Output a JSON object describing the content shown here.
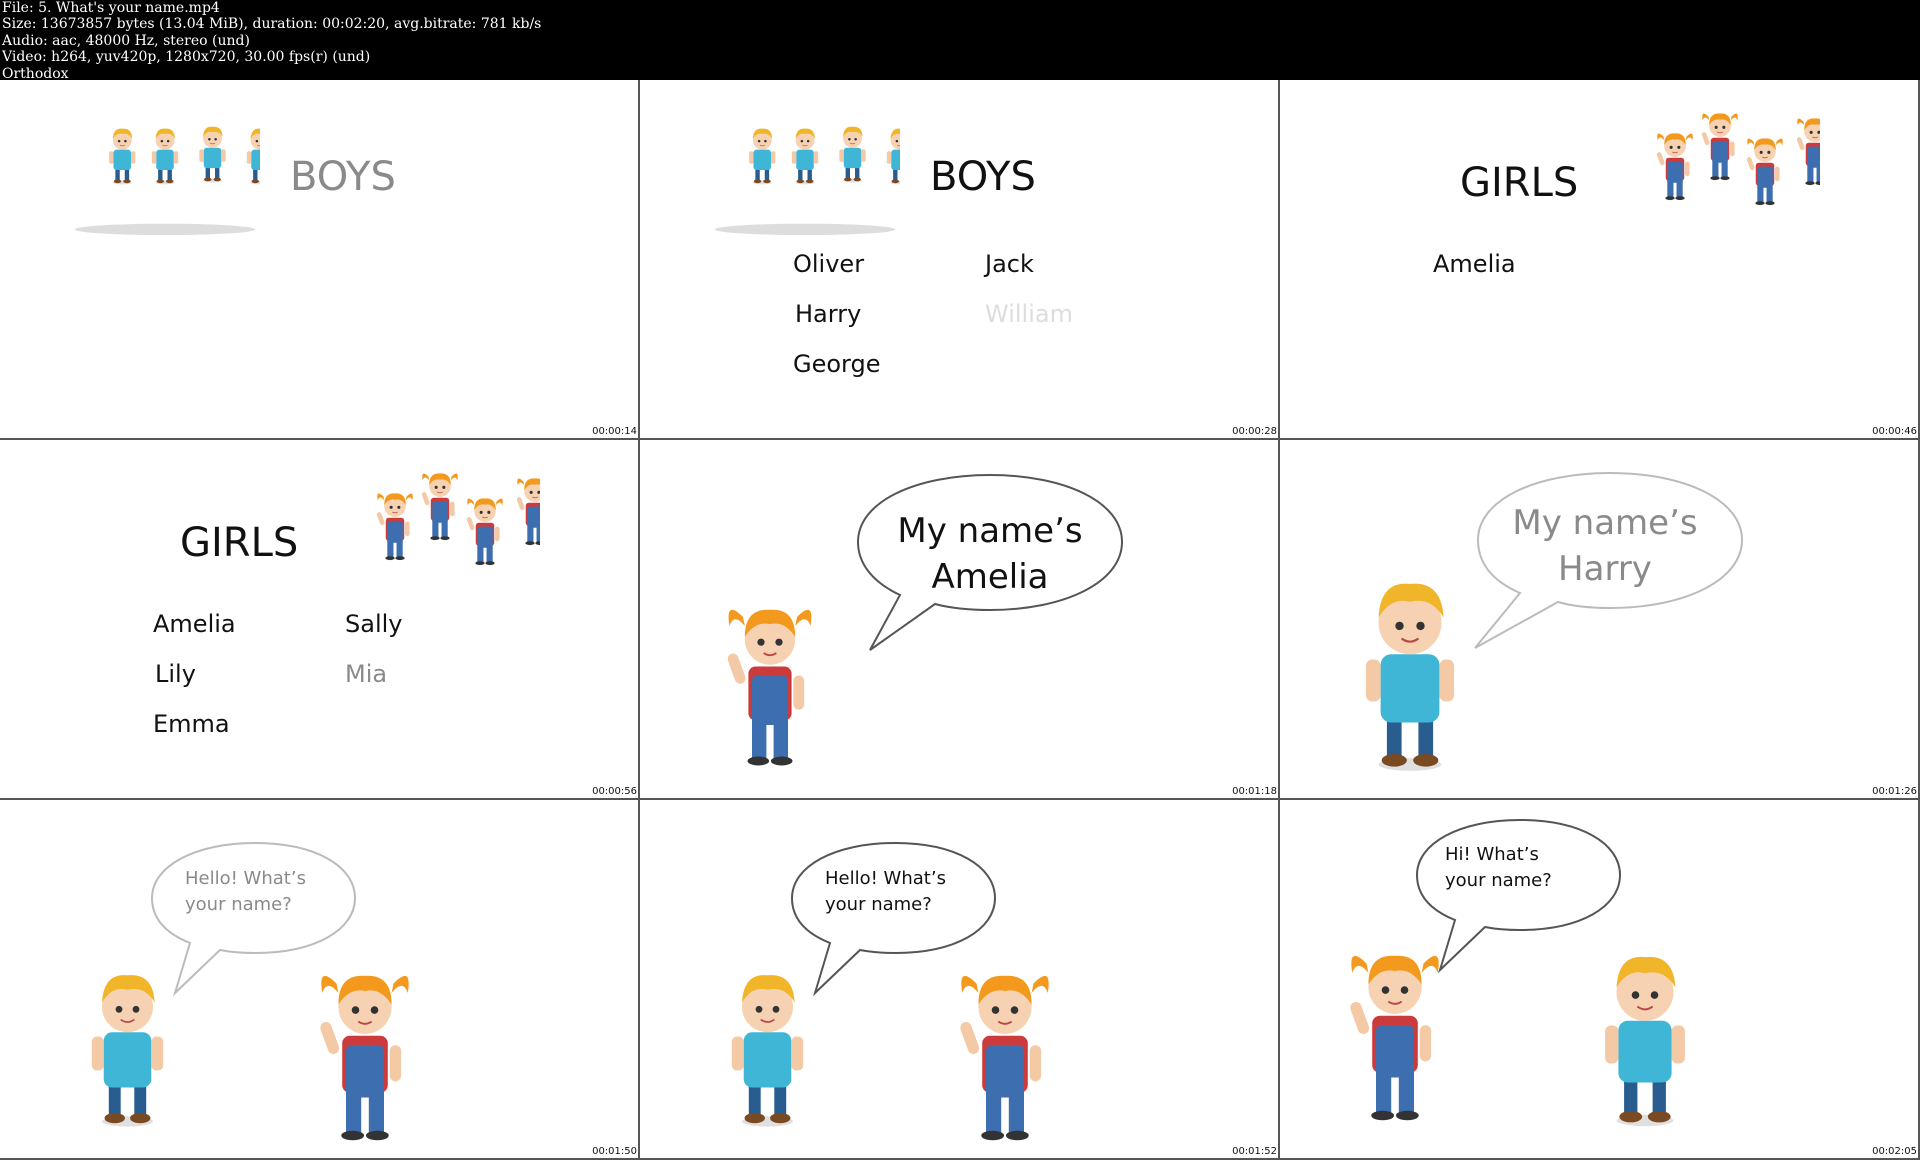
{
  "header": {
    "file": "File: 5. What's your name.mp4",
    "size": "Size: 13673857 bytes (13.04 MiB), duration: 00:02:20, avg.bitrate: 781 kb/s",
    "audio": "Audio: aac, 48000 Hz, stereo (und)",
    "video": "Video: h264, yuv420p, 1280x720, 30.00 fps(r) (und)",
    "tag": "Orthodox"
  },
  "frames": [
    {
      "timestamp": "00:00:14",
      "title": "BOYS"
    },
    {
      "timestamp": "00:00:28",
      "title": "BOYS",
      "names": [
        "Oliver",
        "Jack",
        "Harry",
        "William",
        "George"
      ]
    },
    {
      "timestamp": "00:00:46",
      "title": "GIRLS",
      "names": [
        "Amelia"
      ]
    },
    {
      "timestamp": "00:00:56",
      "title": "GIRLS",
      "names": [
        "Amelia",
        "Sally",
        "Lily",
        "Mia",
        "Emma"
      ]
    },
    {
      "timestamp": "00:01:18",
      "bubble": [
        "My name’s",
        "Amelia"
      ]
    },
    {
      "timestamp": "00:01:26",
      "bubble": [
        "My name’s",
        "Harry"
      ]
    },
    {
      "timestamp": "00:01:50",
      "bubble": [
        "Hello! What’s",
        "your name?"
      ]
    },
    {
      "timestamp": "00:01:52",
      "bubble": [
        "Hello! What’s",
        "your name?"
      ]
    },
    {
      "timestamp": "00:02:05",
      "bubble": [
        "Hi! What’s",
        "your name?"
      ]
    }
  ],
  "colors": {
    "header_bg": "#000000",
    "text_dark": "#111111",
    "text_faded": "#8a8a8a",
    "text_very_faded": "#dddddd"
  }
}
